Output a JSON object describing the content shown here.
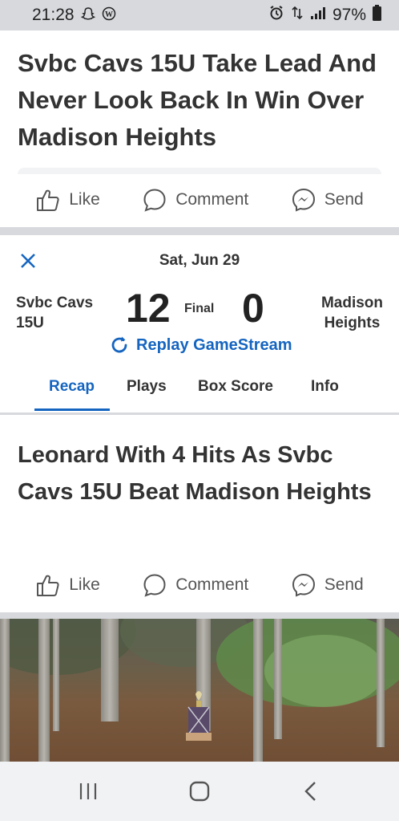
{
  "status_bar": {
    "time": "21:28",
    "left_icons": [
      "snapchat-icon",
      "wordpress-icon"
    ],
    "right_icons": [
      "alarm-icon",
      "data-icon",
      "signal-icon"
    ],
    "battery": "97%"
  },
  "article1": {
    "headline": "Svbc Cavs 15U Take Lead And Never Look Back In Win Over Madison Heights",
    "actions": {
      "like": "Like",
      "comment": "Comment",
      "send": "Send"
    }
  },
  "game": {
    "date": "Sat, Jun 29",
    "home": {
      "name_line1": "Svbc Cavs",
      "name_line2": "15U",
      "score": "12"
    },
    "away": {
      "name_line1": "Madison",
      "name_line2": "Heights",
      "score": "0"
    },
    "status": "Final",
    "replay_label": "Replay GameStream",
    "tabs": [
      {
        "label": "Recap",
        "active": true
      },
      {
        "label": "Plays",
        "active": false
      },
      {
        "label": "Box Score",
        "active": false
      },
      {
        "label": "Info",
        "active": false
      }
    ],
    "accent_color": "#1565c0"
  },
  "article2": {
    "headline": "Leonard With 4 Hits As Svbc Cavs 15U Beat Madison Heights",
    "actions": {
      "like": "Like",
      "comment": "Comment",
      "send": "Send"
    }
  },
  "nav_bar": {
    "buttons": [
      "recent-apps-icon",
      "home-icon",
      "back-icon"
    ]
  }
}
